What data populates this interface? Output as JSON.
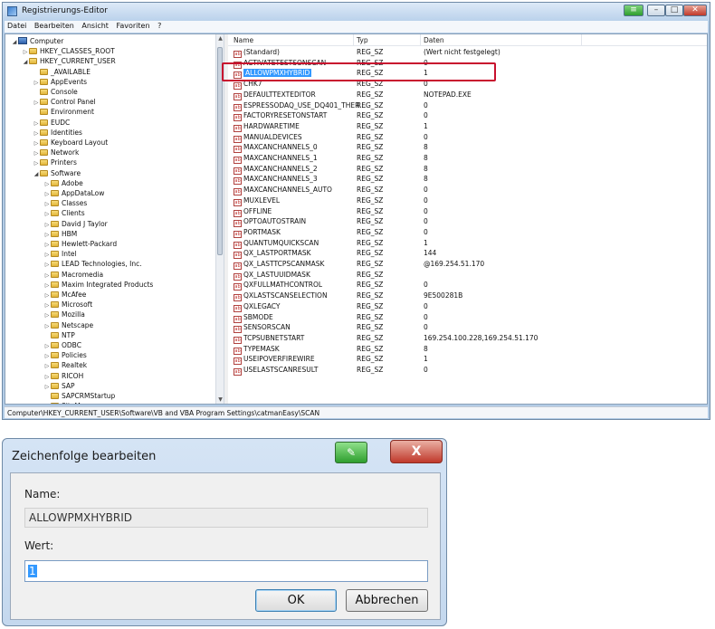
{
  "registry_editor": {
    "title": "Registrierungs-Editor",
    "window_buttons": {
      "green": "≡",
      "minimize": "–",
      "maximize": "□",
      "close": "✕"
    },
    "menu": [
      "Datei",
      "Bearbeiten",
      "Ansicht",
      "Favoriten",
      "?"
    ],
    "tree": [
      {
        "label": "Computer",
        "level": 0,
        "expander": "◢",
        "icon": "computer-icon"
      },
      {
        "label": "HKEY_CLASSES_ROOT",
        "level": 1,
        "expander": "▷",
        "icon": "folder-icon"
      },
      {
        "label": "HKEY_CURRENT_USER",
        "level": 1,
        "expander": "◢",
        "icon": "folder-icon"
      },
      {
        "label": "_AVAILABLE",
        "level": 2,
        "expander": "",
        "icon": "folder-icon"
      },
      {
        "label": "AppEvents",
        "level": 2,
        "expander": "▷",
        "icon": "folder-icon"
      },
      {
        "label": "Console",
        "level": 2,
        "expander": "",
        "icon": "folder-icon"
      },
      {
        "label": "Control Panel",
        "level": 2,
        "expander": "▷",
        "icon": "folder-icon"
      },
      {
        "label": "Environment",
        "level": 2,
        "expander": "",
        "icon": "folder-icon"
      },
      {
        "label": "EUDC",
        "level": 2,
        "expander": "▷",
        "icon": "folder-icon"
      },
      {
        "label": "Identities",
        "level": 2,
        "expander": "▷",
        "icon": "folder-icon"
      },
      {
        "label": "Keyboard Layout",
        "level": 2,
        "expander": "▷",
        "icon": "folder-icon"
      },
      {
        "label": "Network",
        "level": 2,
        "expander": "▷",
        "icon": "folder-icon"
      },
      {
        "label": "Printers",
        "level": 2,
        "expander": "▷",
        "icon": "folder-icon"
      },
      {
        "label": "Software",
        "level": 2,
        "expander": "◢",
        "icon": "folder-icon"
      },
      {
        "label": "Adobe",
        "level": 3,
        "expander": "▷",
        "icon": "folder-icon"
      },
      {
        "label": "AppDataLow",
        "level": 3,
        "expander": "▷",
        "icon": "folder-icon"
      },
      {
        "label": "Classes",
        "level": 3,
        "expander": "▷",
        "icon": "folder-icon"
      },
      {
        "label": "Clients",
        "level": 3,
        "expander": "▷",
        "icon": "folder-icon"
      },
      {
        "label": "David J Taylor",
        "level": 3,
        "expander": "▷",
        "icon": "folder-icon"
      },
      {
        "label": "HBM",
        "level": 3,
        "expander": "▷",
        "icon": "folder-icon"
      },
      {
        "label": "Hewlett-Packard",
        "level": 3,
        "expander": "▷",
        "icon": "folder-icon"
      },
      {
        "label": "Intel",
        "level": 3,
        "expander": "▷",
        "icon": "folder-icon"
      },
      {
        "label": "LEAD Technologies, Inc.",
        "level": 3,
        "expander": "▷",
        "icon": "folder-icon"
      },
      {
        "label": "Macromedia",
        "level": 3,
        "expander": "▷",
        "icon": "folder-icon"
      },
      {
        "label": "Maxim Integrated Products",
        "level": 3,
        "expander": "▷",
        "icon": "folder-icon"
      },
      {
        "label": "McAfee",
        "level": 3,
        "expander": "▷",
        "icon": "folder-icon"
      },
      {
        "label": "Microsoft",
        "level": 3,
        "expander": "▷",
        "icon": "folder-icon"
      },
      {
        "label": "Mozilla",
        "level": 3,
        "expander": "▷",
        "icon": "folder-icon"
      },
      {
        "label": "Netscape",
        "level": 3,
        "expander": "▷",
        "icon": "folder-icon"
      },
      {
        "label": "NTP",
        "level": 3,
        "expander": "",
        "icon": "folder-icon"
      },
      {
        "label": "ODBC",
        "level": 3,
        "expander": "▷",
        "icon": "folder-icon"
      },
      {
        "label": "Policies",
        "level": 3,
        "expander": "▷",
        "icon": "folder-icon"
      },
      {
        "label": "Realtek",
        "level": 3,
        "expander": "▷",
        "icon": "folder-icon"
      },
      {
        "label": "RICOH",
        "level": 3,
        "expander": "▷",
        "icon": "folder-icon"
      },
      {
        "label": "SAP",
        "level": 3,
        "expander": "▷",
        "icon": "folder-icon"
      },
      {
        "label": "SAPCRMStartup",
        "level": 3,
        "expander": "",
        "icon": "folder-icon"
      },
      {
        "label": "SiteMan",
        "level": 3,
        "expander": "▷",
        "icon": "folder-icon"
      }
    ],
    "scroll_arrows": {
      "up": "▲",
      "down": "▼"
    },
    "columns": {
      "name": "Name",
      "type": "Typ",
      "data": "Daten"
    },
    "values": [
      {
        "name": "(Standard)",
        "type": "REG_SZ",
        "data": "(Wert nicht festgelegt)"
      },
      {
        "name": "ACTIVATETESTSONSCAN",
        "type": "REG_SZ",
        "data": "0"
      },
      {
        "name": "ALLOWPMXHYBRID",
        "type": "REG_SZ",
        "data": "1",
        "selected": true
      },
      {
        "name": "CHK7",
        "type": "REG_SZ",
        "data": "0"
      },
      {
        "name": "DEFAULTTEXTEDITOR",
        "type": "REG_SZ",
        "data": "NOTEPAD.EXE"
      },
      {
        "name": "ESPRESSODAQ_USE_DQ401_THER...",
        "type": "REG_SZ",
        "data": "0"
      },
      {
        "name": "FACTORYRESETONSTART",
        "type": "REG_SZ",
        "data": "0"
      },
      {
        "name": "HARDWARETIME",
        "type": "REG_SZ",
        "data": "1"
      },
      {
        "name": "MANUALDEVICES",
        "type": "REG_SZ",
        "data": "0"
      },
      {
        "name": "MAXCANCHANNELS_0",
        "type": "REG_SZ",
        "data": "8"
      },
      {
        "name": "MAXCANCHANNELS_1",
        "type": "REG_SZ",
        "data": "8"
      },
      {
        "name": "MAXCANCHANNELS_2",
        "type": "REG_SZ",
        "data": "8"
      },
      {
        "name": "MAXCANCHANNELS_3",
        "type": "REG_SZ",
        "data": "8"
      },
      {
        "name": "MAXCANCHANNELS_AUTO",
        "type": "REG_SZ",
        "data": "0"
      },
      {
        "name": "MUXLEVEL",
        "type": "REG_SZ",
        "data": "0"
      },
      {
        "name": "OFFLINE",
        "type": "REG_SZ",
        "data": "0"
      },
      {
        "name": "OPTOAUTOSTRAIN",
        "type": "REG_SZ",
        "data": "0"
      },
      {
        "name": "PORTMASK",
        "type": "REG_SZ",
        "data": "0"
      },
      {
        "name": "QUANTUMQUICKSCAN",
        "type": "REG_SZ",
        "data": "1"
      },
      {
        "name": "QX_LASTPORTMASK",
        "type": "REG_SZ",
        "data": "144"
      },
      {
        "name": "QX_LASTTCPSCANMASK",
        "type": "REG_SZ",
        "data": "@169.254.51.170"
      },
      {
        "name": "QX_LASTUUIDMASK",
        "type": "REG_SZ",
        "data": ""
      },
      {
        "name": "QXFULLMATHCONTROL",
        "type": "REG_SZ",
        "data": "0"
      },
      {
        "name": "QXLASTSCANSELECTION",
        "type": "REG_SZ",
        "data": "9E500281B"
      },
      {
        "name": "QXLEGACY",
        "type": "REG_SZ",
        "data": "0"
      },
      {
        "name": "SBMODE",
        "type": "REG_SZ",
        "data": "0"
      },
      {
        "name": "SENSORSCAN",
        "type": "REG_SZ",
        "data": "0"
      },
      {
        "name": "TCPSUBNETSTART",
        "type": "REG_SZ",
        "data": "169.254.100.228,169.254.51.170"
      },
      {
        "name": "TYPEMASK",
        "type": "REG_SZ",
        "data": "8"
      },
      {
        "name": "USEIPOVERFIREWIRE",
        "type": "REG_SZ",
        "data": "1"
      },
      {
        "name": "USELASTSCANRESULT",
        "type": "REG_SZ",
        "data": "0"
      }
    ],
    "value_icon_text": "ab",
    "status_path": "Computer\\HKEY_CURRENT_USER\\Software\\VB and VBA Program Settings\\catmanEasy\\SCAN"
  },
  "edit_dialog": {
    "title": "Zeichenfolge bearbeiten",
    "green_button": "✎",
    "close_button": "X",
    "name_label": "Name:",
    "name_value": "ALLOWPMXHYBRID",
    "value_label": "Wert:",
    "value_value": "1",
    "ok_label": "OK",
    "cancel_label": "Abbrechen"
  },
  "colors": {
    "highlight_border": "#c8102e",
    "selection": "#3399ff"
  }
}
